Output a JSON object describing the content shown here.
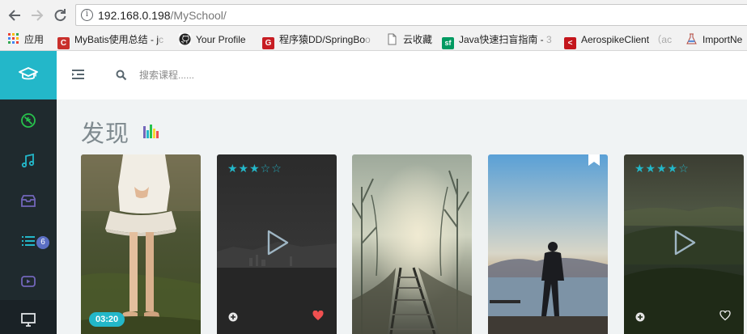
{
  "browser": {
    "url_host": "192.168.0.198",
    "url_path": "/MySchool/",
    "bookmarks": [
      {
        "label": "应用",
        "icon": "apps-icon"
      },
      {
        "label": "MyBatis使用总结 - j",
        "faded": "c",
        "icon": "csdn-icon",
        "color": "#c9302c"
      },
      {
        "label": "Your Profile",
        "icon": "github-icon"
      },
      {
        "label": "程序猿DD/SpringBo",
        "faded": "o",
        "icon": "gitee-icon",
        "color": "#c71d23"
      },
      {
        "label": "云收藏",
        "icon": "page-icon"
      },
      {
        "label": "Java快速扫盲指南 - ",
        "faded": "3",
        "icon": "segmentfault-icon",
        "color": "#009a61"
      },
      {
        "label": "AerospikeClient",
        "faded": "（ac",
        "icon": "aerospike-icon",
        "color": "#c4161c"
      },
      {
        "label": "ImportNe",
        "icon": "flask-icon"
      }
    ]
  },
  "sidebar": {
    "badge_count": "6",
    "items": [
      "compass-icon",
      "music-icon",
      "inbox-icon",
      "list-icon",
      "play-icon",
      "monitor-icon"
    ]
  },
  "topbar": {
    "search_placeholder": "搜索课程......"
  },
  "page": {
    "title": "发现"
  },
  "cards": [
    {
      "duration": "03:20",
      "stars": 0
    },
    {
      "stars": 3,
      "max_stars": 5,
      "play": true,
      "liked": true
    },
    {
      "stars": 0
    },
    {
      "bookmarked": true
    },
    {
      "stars": 4,
      "max_stars": 5,
      "play": true,
      "liked": false
    }
  ],
  "colors": {
    "accent": "#23b7c9",
    "sidebar": "#1f2a2e",
    "heart": "#f05050",
    "badge": "#5b6fc4"
  }
}
